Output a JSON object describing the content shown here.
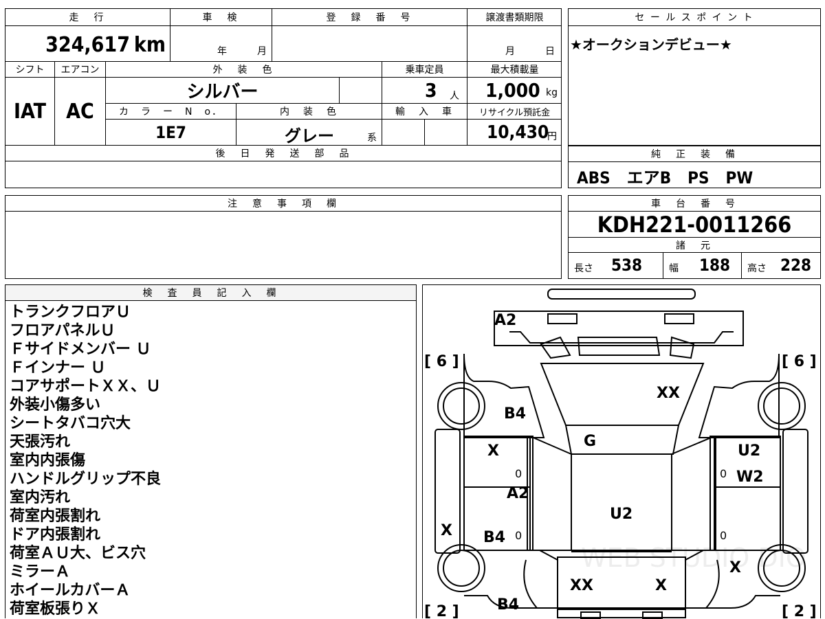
{
  "top_left": {
    "mileage_header": "走　行",
    "mileage_value": "324,617",
    "mileage_unit": "km",
    "inspection_header": "車　検",
    "inspection_year_label": "年",
    "inspection_month_label": "月",
    "registration_header": "登　録　番　号",
    "transfer_deadline_header": "譲渡書類期限",
    "transfer_month_label": "月",
    "transfer_day_label": "日",
    "shift_header": "シフト",
    "aircon_header": "エアコン",
    "exterior_color_header": "外　装　色",
    "capacity_header": "乗車定員",
    "max_load_header": "最大積載量",
    "shift_value": "IAT",
    "aircon_value": "AC",
    "exterior_color_value": "シルバー",
    "capacity_value": "3",
    "capacity_unit": "人",
    "max_load_value": "1,000",
    "max_load_unit": "kg",
    "color_no_header": "カ　ラ　ー　N　o．",
    "interior_color_header": "内　装　色",
    "import_header": "輸　入　車",
    "recycle_header": "リサイクル預託金",
    "color_no_value": "1E7",
    "interior_color_value": "グレー",
    "interior_color_suffix": "系",
    "recycle_value": "10,430",
    "recycle_unit": "円",
    "later_parts_header": "後　日　発　送　部　品",
    "notes_header": "注　意　事　項　欄"
  },
  "sales_point": {
    "header": "セ ー ル ス ポ イ ン ト",
    "text": "★オークションデビュー★"
  },
  "equipment": {
    "header": "純　正　装　備",
    "text": "ABS　エアB　PS　PW"
  },
  "chassis": {
    "header": "車　台　番　号",
    "value": "KDH221-0011266",
    "specs_header": "諸　元",
    "length_label": "長さ",
    "length_value": "538",
    "width_label": "幅",
    "width_value": "188",
    "height_label": "高さ",
    "height_value": "228"
  },
  "inspector": {
    "header": "検　査　員　記　入　欄",
    "lines": [
      "トランクフロアＵ",
      "フロアパネルＵ",
      "Ｆサイドメンバー Ｕ",
      "Ｆインナー Ｕ",
      "コアサポートＸＸ、Ｕ",
      "外装小傷多い",
      "シートタバコ穴大",
      "天張汚れ",
      "室内内張傷",
      "ハンドルグリップ不良",
      "室内汚れ",
      "荷室内張割れ",
      "ドア内張割れ",
      "荷室ＡＵ大、ビス穴",
      "ミラーＡ",
      "ホイールカバーＡ",
      "荷室板張りＸ"
    ]
  },
  "diagram": {
    "tire_front_left": "[ 6 ]",
    "tire_front_right": "[ 6 ]",
    "tire_rear_left": "[ 2 ]",
    "tire_rear_right": "[ 2 ]",
    "marks": {
      "front_bumper": "A2",
      "hood": "XX",
      "left_front_fender": "B4",
      "windshield": "G",
      "left_front_door": "X",
      "right_front_door": "U2",
      "right_front_door_lower": "W2",
      "left_pillar": "A2",
      "roof": "U2",
      "left_rear_door": "B4",
      "left_side": "X",
      "right_rear": "X",
      "rear_left": "XX",
      "rear_right": "X",
      "rear_bumper": "B4"
    },
    "zeros": [
      "0",
      "0",
      "0",
      "0"
    ],
    "watermark": "WEB STUDIO DIO"
  }
}
